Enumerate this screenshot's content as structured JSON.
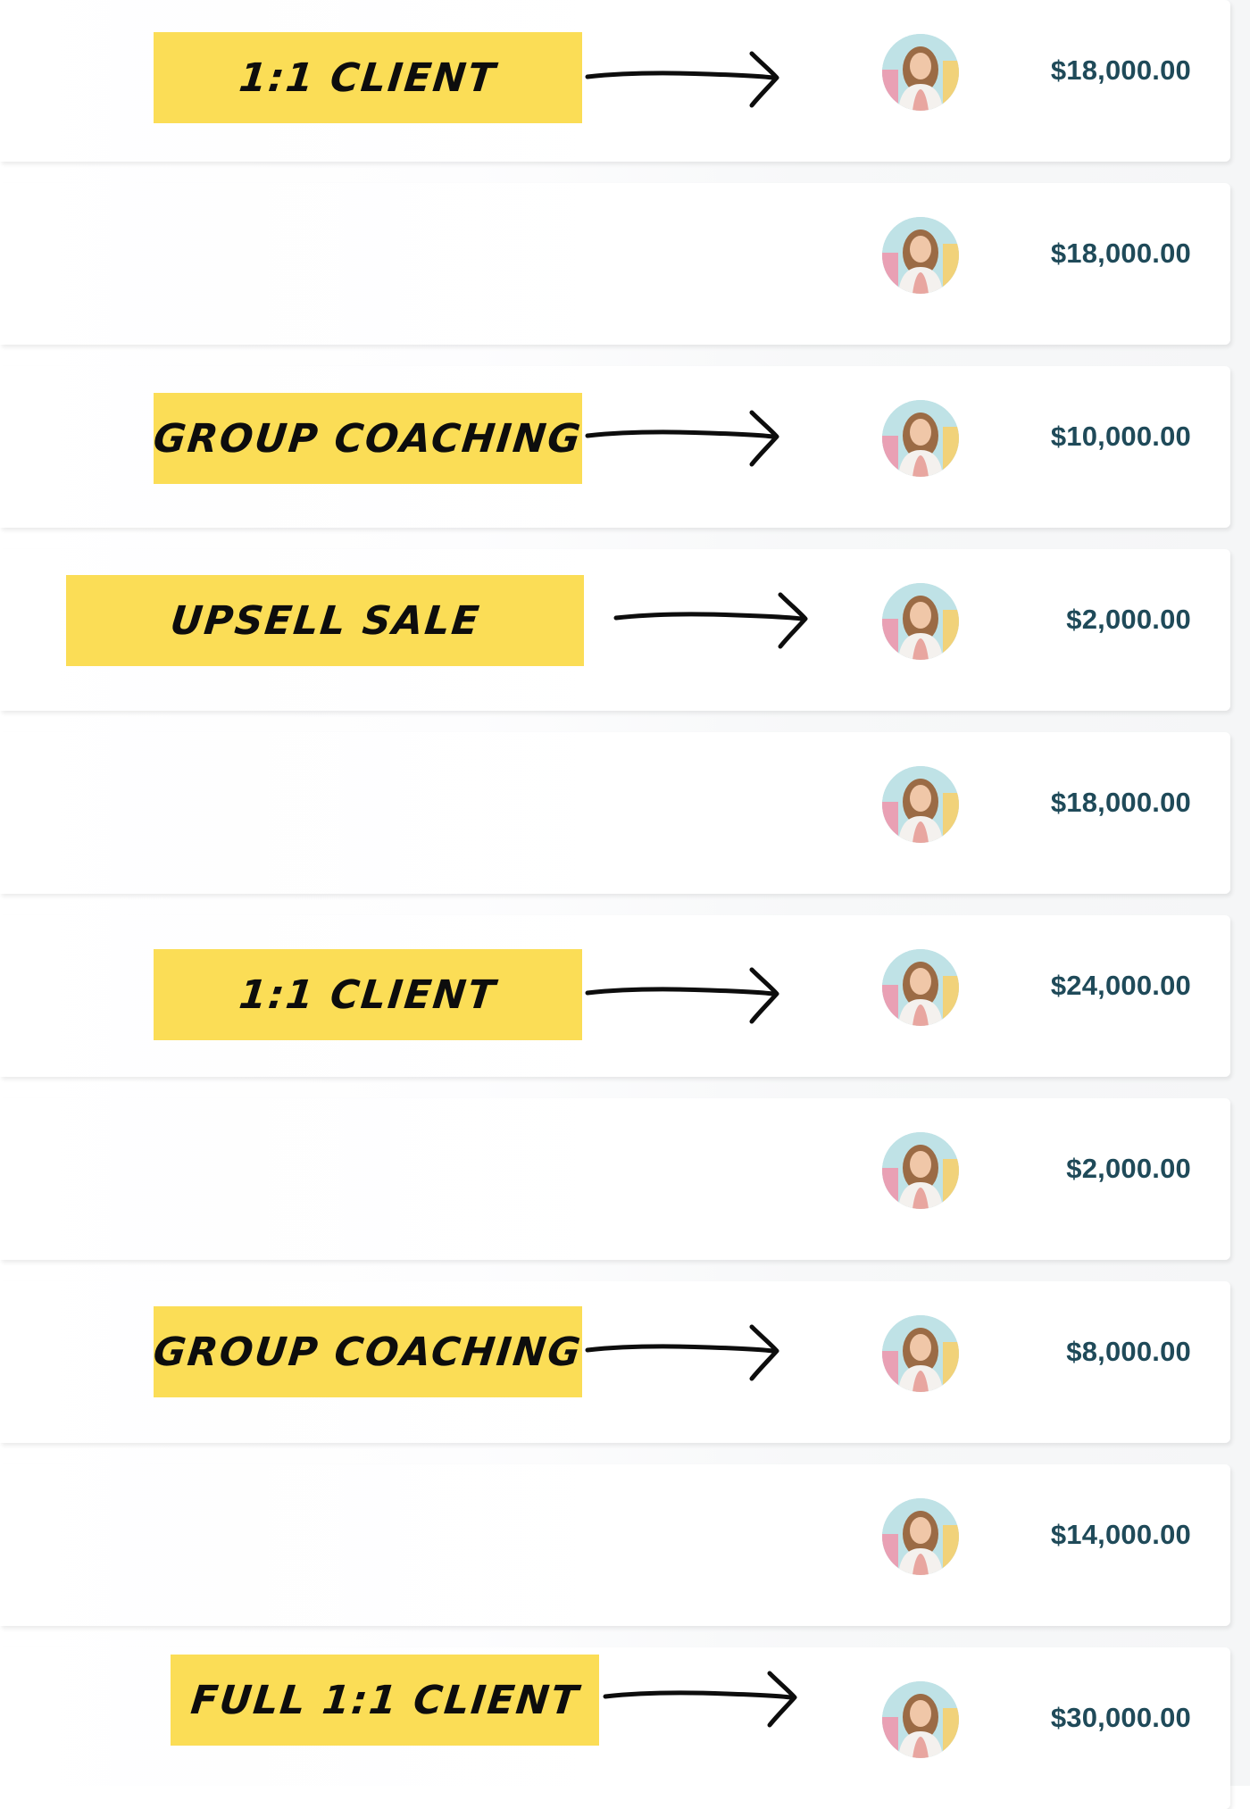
{
  "accent_colors": {
    "tag_background": "#fbdd56",
    "amount_text": "#1f4a59",
    "card_background": "#ffffff"
  },
  "rows": [
    {
      "tag": "1:1 client",
      "amount": "$18,000.00",
      "avatar": "avatar-photo"
    },
    {
      "tag": "",
      "amount": "$18,000.00",
      "avatar": "avatar-photo"
    },
    {
      "tag": "group coaching",
      "amount": "$10,000.00",
      "avatar": "avatar-photo"
    },
    {
      "tag": "upsell sale",
      "amount": "$2,000.00",
      "avatar": "avatar-photo"
    },
    {
      "tag": "",
      "amount": "$18,000.00",
      "avatar": "avatar-photo"
    },
    {
      "tag": "1:1 client",
      "amount": "$24,000.00",
      "avatar": "avatar-photo"
    },
    {
      "tag": "",
      "amount": "$2,000.00",
      "avatar": "avatar-photo"
    },
    {
      "tag": "group coaching",
      "amount": "$8,000.00",
      "avatar": "avatar-photo"
    },
    {
      "tag": "",
      "amount": "$14,000.00",
      "avatar": "avatar-photo"
    },
    {
      "tag": "full 1:1 client",
      "amount": "$30,000.00",
      "avatar": "avatar-photo"
    }
  ]
}
